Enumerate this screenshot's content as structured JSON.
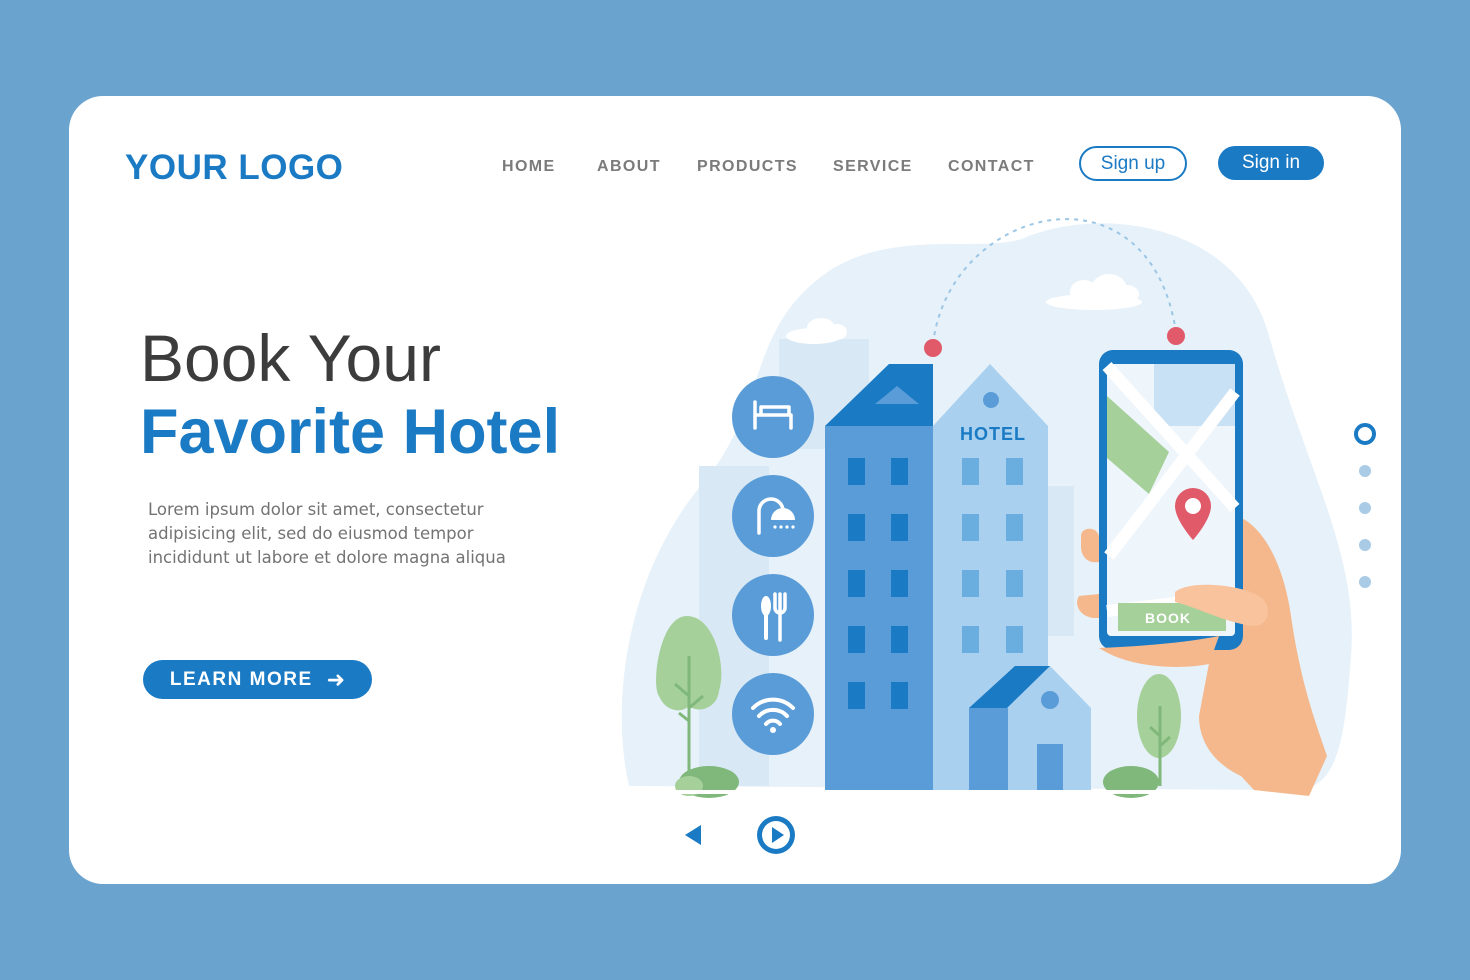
{
  "logo": "YOUR LOGO",
  "nav": [
    "HOME",
    "ABOUT",
    "PRODUCTS",
    "SERVICE",
    "CONTACT"
  ],
  "auth": {
    "signup": "Sign up",
    "signin": "Sign in"
  },
  "hero": {
    "title_line1": "Book Your",
    "title_line2": "Favorite Hotel",
    "description": "Lorem ipsum dolor sit amet, consectetur adipisicing elit, sed do eiusmod tempor incididunt ut labore et dolore magna aliqua",
    "cta": "LEARN MORE",
    "cta_icon": "arrow-right-icon"
  },
  "illustration": {
    "hotel_sign": "HOTEL",
    "phone_button": "BOOK",
    "amenity_icons": [
      "bed-icon",
      "shower-icon",
      "cutlery-icon",
      "wifi-icon"
    ]
  },
  "carousel": {
    "slide_count": 5,
    "active_slide": 1
  },
  "media_controls": [
    "previous-icon",
    "play-icon"
  ],
  "colors": {
    "background": "#6ba3cf",
    "accent": "#1a7ac4",
    "building_dark": "#5a9cd8",
    "building_light": "#a9d0ef",
    "tree": "#a6d09a",
    "marker": "#e05a6a",
    "skin": "#f5b88c"
  }
}
